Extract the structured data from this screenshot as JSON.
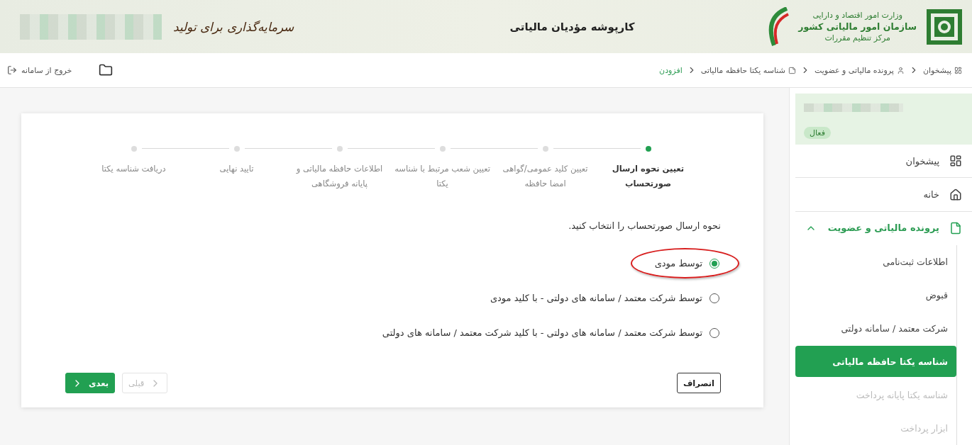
{
  "header": {
    "ministry": "وزارت امور اقتصاد و دارایی",
    "organization": "سازمان امور مالیاتی کشور",
    "center": "مرکز تنظیم مقررات",
    "title": "کارپوشه مؤدیان مالیاتی",
    "slogan": "سرمایه‌گذاری برای تولید"
  },
  "breadcrumb": [
    {
      "label": "پیشخوان",
      "current": false
    },
    {
      "label": "پرونده مالیاتی و عضویت",
      "current": false
    },
    {
      "label": "شناسه یکتا حافظه مالیاتی",
      "current": false
    },
    {
      "label": "افزودن",
      "current": true
    }
  ],
  "toolbar": {
    "logout": "خروج از سامانه"
  },
  "sidebar": {
    "status_badge": "فعال",
    "items": [
      {
        "label": "پیشخوان",
        "selected": false
      },
      {
        "label": "خانه",
        "selected": false
      },
      {
        "label": "پرونده مالیاتی و عضویت",
        "selected": true,
        "expanded": true,
        "children": [
          {
            "label": "اطلاعات ثبت‌نامی",
            "selected": false,
            "disabled": false
          },
          {
            "label": "قبوض",
            "selected": false,
            "disabled": false
          },
          {
            "label": "شرکت معتمد / سامانه دولتی",
            "selected": false,
            "disabled": false
          },
          {
            "label": "شناسه یکتا حافظه مالیاتی",
            "selected": true,
            "disabled": false
          },
          {
            "label": "شناسه یکتا پایانه پرداخت",
            "selected": false,
            "disabled": true
          },
          {
            "label": "ابزار پرداخت",
            "selected": false,
            "disabled": true
          }
        ]
      }
    ]
  },
  "stepper": {
    "steps": [
      {
        "label": "تعیین نحوه ارسال صورتحساب",
        "selected": true
      },
      {
        "label": "تعیین کلید عمومی/گواهی امضا حافظه",
        "selected": false
      },
      {
        "label": "تعیین شعب مرتبط با شناسه یکتا",
        "selected": false
      },
      {
        "label": "اطلاعات حافظه مالیاتی و پایانه فروشگاهی",
        "selected": false
      },
      {
        "label": "تایید نهایی",
        "selected": false
      },
      {
        "label": "دریافت شناسه یکتا",
        "selected": false
      }
    ]
  },
  "form": {
    "prompt": "نحوه ارسال صورتحساب را انتخاب کنید.",
    "options": [
      {
        "label": "توسط مودی",
        "selected": true,
        "annotated": true
      },
      {
        "label": "توسط شرکت معتمد / سامانه های دولتی - با کلید مودی",
        "selected": false,
        "annotated": false
      },
      {
        "label": "توسط شرکت معتمد / سامانه های دولتی - با کلید شرکت معتمد / سامانه های دولتی",
        "selected": false,
        "annotated": false
      }
    ],
    "cancel": "انصراف",
    "previous": {
      "label": "قبلی",
      "disabled": true
    },
    "next": {
      "label": "بعدی",
      "disabled": false
    }
  }
}
